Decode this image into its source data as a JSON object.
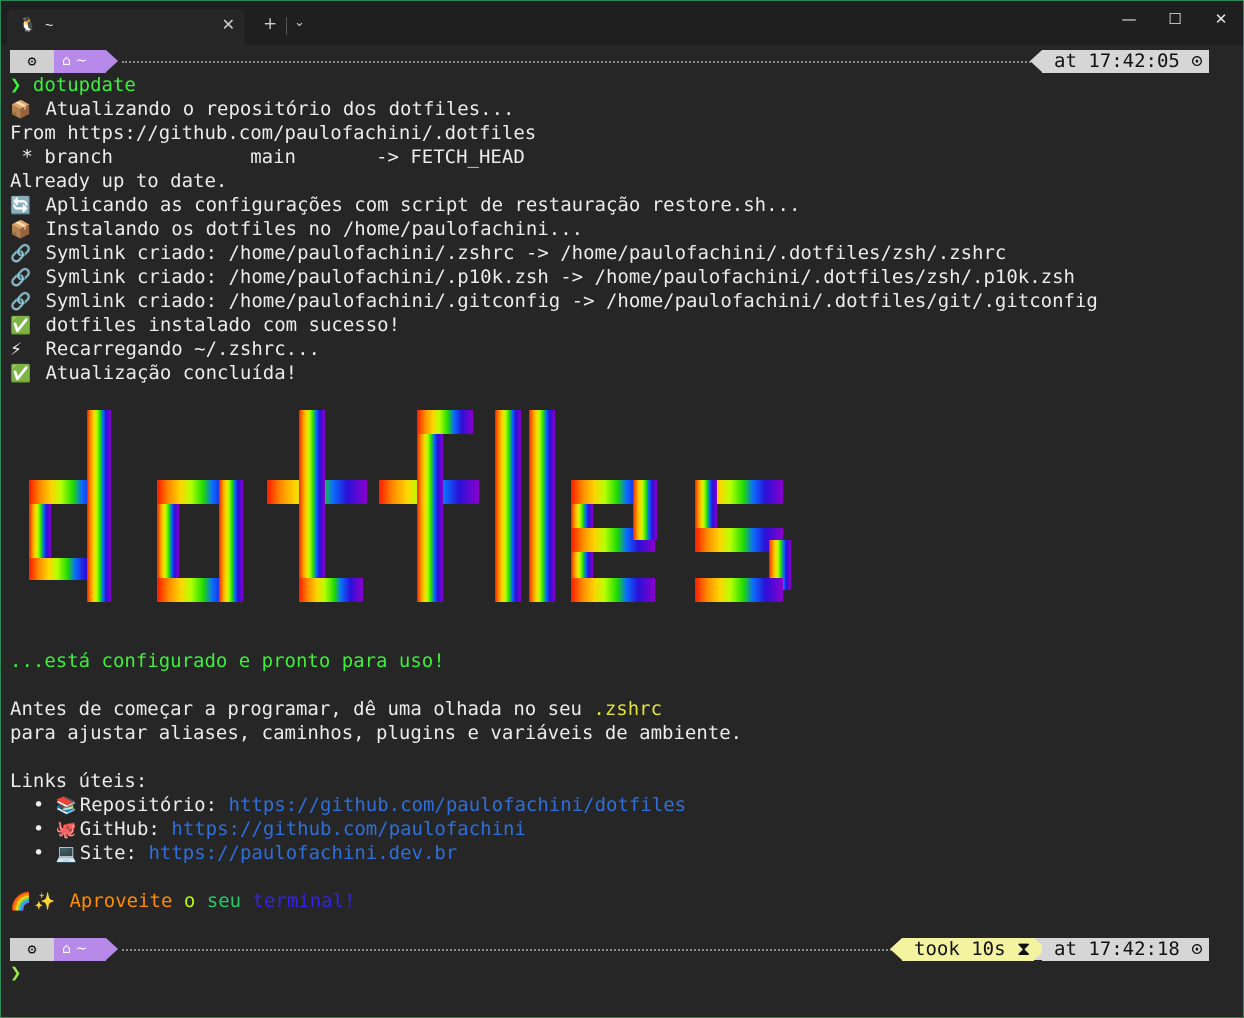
{
  "window": {
    "tab_icon": "linux-penguin-icon",
    "tab_title": "~",
    "tab_close": "✕",
    "new_tab": "+",
    "dropdown": "⌄",
    "minimize": "—",
    "maximize": "☐",
    "close": "✕"
  },
  "prompt1": {
    "dir_symbol": "⌂ ~",
    "time": "at 17:42:05 ⊙"
  },
  "lines": {
    "cmd_caret": "❯",
    "cmd": "dotupdate",
    "l1": "Atualizando o repositório dos dotfiles...",
    "l2": "From https://github.com/paulofachini/.dotfiles",
    "l3": " * branch            main       -> FETCH_HEAD",
    "l4": "Already up to date.",
    "l5": "Aplicando as configurações com script de restauração restore.sh...",
    "l6": "Instalando os dotfiles no /home/paulofachini...",
    "l7": "Symlink criado: /home/paulofachini/.zshrc -> /home/paulofachini/.dotfiles/zsh/.zshrc",
    "l8": "Symlink criado: /home/paulofachini/.p10k.zsh -> /home/paulofachini/.dotfiles/zsh/.p10k.zsh",
    "l9": "Symlink criado: /home/paulofachini/.gitconfig -> /home/paulofachini/.dotfiles/git/.gitconfig",
    "l10": "dotfiles instalado com sucesso!",
    "l11": "Recarregando ~/.zshrc...",
    "l12": "Atualização concluída!"
  },
  "emoji": {
    "package": "📦",
    "sync": "🔄",
    "link": "🔗",
    "check": "✅",
    "bolt": "⚡",
    "books": "📚",
    "octopus": "🐙",
    "laptop": "💻",
    "rainbow": "🌈",
    "sparkles": "✨"
  },
  "banner": {
    "word": "dotfiles",
    "colors": [
      "#ff2200",
      "#ff8800",
      "#ffd400",
      "#b6ff00",
      "#22dd00",
      "#0066ff",
      "#3300dd",
      "#8a00cc"
    ]
  },
  "ready": "...está configurado e pronto para uso!",
  "advice": {
    "p1_prefix": "Antes de começar a programar, dê uma olhada no seu ",
    "p1_file": ".zshrc",
    "p2": "para ajustar aliases, caminhos, plugins e variáveis de ambiente."
  },
  "links": {
    "header": "Links úteis:",
    "bullet": "•",
    "items": [
      {
        "label": "Repositório: ",
        "url": "https://github.com/paulofachini/dotfiles"
      },
      {
        "label": "GitHub: ",
        "url": "https://github.com/paulofachini"
      },
      {
        "label": "Site: ",
        "url": "https://paulofachini.dev.br"
      }
    ]
  },
  "enjoy": {
    "w1": "Aproveite",
    "w2": "o",
    "w3": "seu",
    "w4": "terminal!"
  },
  "prompt2": {
    "dir_symbol": "⌂ ~",
    "took": "took 10s ⧗",
    "time": "at 17:42:18 ⊙",
    "caret": "❯"
  },
  "colors": {
    "terminal_bg": "#262626",
    "text": "#ececec",
    "green": "#3cf03c",
    "link": "#2d6fdc",
    "dir_segment": "#b789e8"
  }
}
